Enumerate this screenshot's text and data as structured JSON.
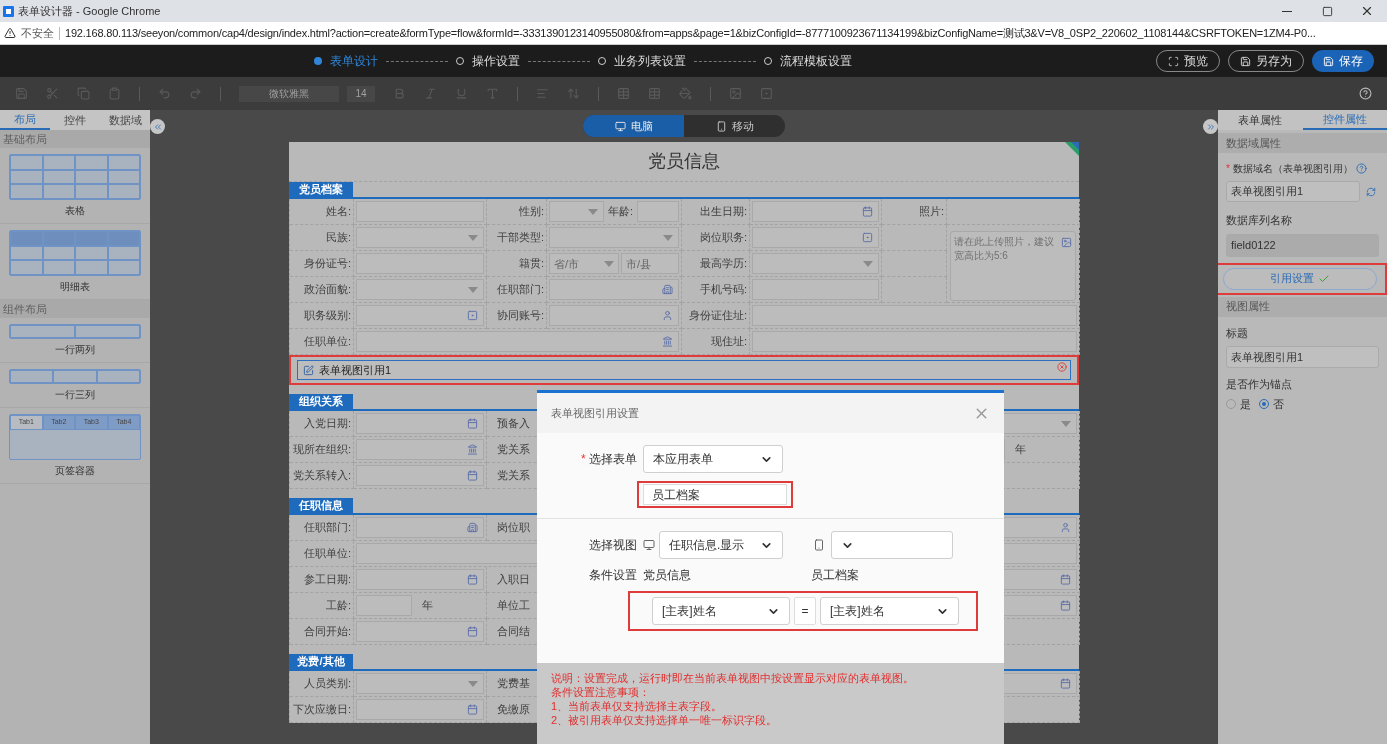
{
  "browser": {
    "title": "表单设计器 - Google Chrome",
    "security": "不安全",
    "url": "192.168.80.113/seeyon/common/cap4/design/index.html?action=create&formType=flow&formId=-3331390123140955080&from=apps&page=1&bizConfigId=-8777100923671134199&bizConfigName=测试3&V=V8_0SP2_220602_1108144&CSRFTOKEN=1ZM4-P0..."
  },
  "steps": [
    {
      "label": "表单设计",
      "selected": true
    },
    {
      "label": "操作设置",
      "selected": false
    },
    {
      "label": "业务列表设置",
      "selected": false
    },
    {
      "label": "流程模板设置",
      "selected": false
    }
  ],
  "header_buttons": [
    {
      "label": "预览",
      "kind": "preview"
    },
    {
      "label": "另存为",
      "kind": "saveas"
    },
    {
      "label": "保存",
      "kind": "save"
    }
  ],
  "toolbar": {
    "font": "微软雅黑",
    "size": "14"
  },
  "left_panel": {
    "tabs": [
      {
        "label": "布局",
        "selected": true
      },
      {
        "label": "控件",
        "selected": false
      },
      {
        "label": "数据域",
        "selected": false
      }
    ],
    "groups": [
      {
        "title": "基础布局",
        "items": [
          {
            "label": "表格",
            "kind": "table"
          },
          {
            "label": "明细表",
            "kind": "detail"
          }
        ]
      },
      {
        "title": "组件布局",
        "items": [
          {
            "label": "一行两列",
            "kind": "two"
          },
          {
            "label": "一行三列",
            "kind": "three"
          },
          {
            "label": "页签容器",
            "kind": "tabs",
            "tabs": [
              "Tab1",
              "Tab2",
              "Tab3",
              "Tab4"
            ]
          }
        ]
      }
    ]
  },
  "device_toggle": [
    {
      "label": "电脑",
      "kind": "desktop",
      "selected": true
    },
    {
      "label": "移动",
      "kind": "mobile",
      "selected": false
    }
  ],
  "form": {
    "title": "党员信息",
    "main_section": {
      "title": "党员档案",
      "rows": [
        [
          {
            "kind": "label",
            "text": "姓名:"
          },
          {
            "kind": "field"
          },
          {
            "kind": "label",
            "text": "性别:"
          },
          {
            "kind": "pair",
            "text": "年龄:"
          },
          {
            "kind": "label",
            "text": "出生日期:"
          },
          {
            "kind": "date"
          },
          {
            "kind": "label",
            "text": "照片:"
          },
          ""
        ],
        [
          {
            "kind": "label",
            "text": "民族:"
          },
          {
            "kind": "select"
          },
          {
            "kind": "label",
            "text": "干部类型:"
          },
          {
            "kind": "select"
          },
          {
            "kind": "label",
            "text": "岗位职务:"
          },
          {
            "kind": "popup"
          },
          "",
          {
            "kind": "photo",
            "text": "请在此上传照片，建议宽高比为5:6"
          }
        ],
        [
          {
            "kind": "label",
            "text": "身份证号:"
          },
          {
            "kind": "field"
          },
          {
            "kind": "label",
            "text": "籍贯:"
          },
          {
            "kind": "region",
            "placeholders": [
              "省/市",
              "市/县"
            ]
          },
          {
            "kind": "label",
            "text": "最高学历:"
          },
          {
            "kind": "select"
          },
          "",
          {
            "kind": "merged_up"
          }
        ],
        [
          {
            "kind": "label",
            "text": "政治面貌:"
          },
          {
            "kind": "select"
          },
          {
            "kind": "label",
            "text": "任职部门:"
          },
          {
            "kind": "dept"
          },
          {
            "kind": "label",
            "text": "手机号码:"
          },
          {
            "kind": "field"
          },
          "",
          {
            "kind": "merged_up"
          }
        ],
        [
          {
            "kind": "label",
            "text": "职务级别:"
          },
          {
            "kind": "popup"
          },
          {
            "kind": "label",
            "text": "协同账号:"
          },
          {
            "kind": "person"
          },
          {
            "kind": "label",
            "text": "身份证住址:"
          },
          {
            "kind": "field"
          },
          {
            "kind": "merged"
          },
          {
            "kind": "merged"
          }
        ],
        [
          {
            "kind": "label",
            "text": "任职单位:"
          },
          {
            "kind": "org"
          },
          {
            "kind": "merged"
          },
          {
            "kind": "merged"
          },
          {
            "kind": "label",
            "text": "现住址:"
          },
          {
            "kind": "field"
          },
          {
            "kind": "merged"
          },
          {
            "kind": "merged"
          }
        ]
      ]
    },
    "reference": {
      "label": "表单视图引用1",
      "highlighted": true
    },
    "sections": [
      {
        "title": "组织关系",
        "rows": [
          [
            {
              "kind": "label",
              "text": "入党日期:"
            },
            {
              "kind": "date"
            },
            {
              "kind": "caption",
              "text": "预备入"
            },
            "",
            "",
            "",
            "",
            {
              "kind": "select"
            }
          ],
          [
            {
              "kind": "label",
              "text": "现所在组织:"
            },
            {
              "kind": "org"
            },
            {
              "kind": "caption",
              "text": "党关系"
            },
            "",
            "",
            "",
            "",
            {
              "kind": "unit",
              "text": "年"
            }
          ],
          [
            {
              "kind": "label",
              "text": "党关系转入:"
            },
            {
              "kind": "date"
            },
            {
              "kind": "caption",
              "text": "党关系"
            },
            "",
            "",
            "",
            "",
            ""
          ]
        ]
      },
      {
        "title": "任职信息",
        "rows": [
          [
            {
              "kind": "label",
              "text": "任职部门:"
            },
            {
              "kind": "dept"
            },
            {
              "kind": "caption",
              "text": "岗位职"
            },
            "",
            "",
            "",
            "",
            {
              "kind": "person"
            }
          ],
          [
            {
              "kind": "label",
              "text": "任职单位:"
            },
            {
              "kind": "field"
            },
            {
              "kind": "merged"
            },
            {
              "kind": "merged"
            },
            {
              "kind": "merged"
            },
            {
              "kind": "merged"
            },
            {
              "kind": "merged"
            },
            {
              "kind": "merged"
            }
          ],
          [
            {
              "kind": "label",
              "text": "参工日期:"
            },
            {
              "kind": "date"
            },
            {
              "kind": "caption",
              "text": "入职日"
            },
            "",
            "",
            "",
            "",
            {
              "kind": "date"
            }
          ],
          [
            {
              "kind": "label",
              "text": "工龄:"
            },
            {
              "kind": "unit",
              "text": "年"
            },
            {
              "kind": "caption",
              "text": "单位工"
            },
            "",
            "",
            "",
            "",
            {
              "kind": "date"
            }
          ],
          [
            {
              "kind": "label",
              "text": "合同开始:"
            },
            {
              "kind": "date"
            },
            {
              "kind": "caption",
              "text": "合同结"
            },
            "",
            "",
            "",
            "",
            ""
          ]
        ]
      },
      {
        "title": "党费/其他",
        "rows": [
          [
            {
              "kind": "label",
              "text": "人员类别:"
            },
            {
              "kind": "select"
            },
            {
              "kind": "caption",
              "text": "党费基"
            },
            "",
            "",
            "",
            "",
            {
              "kind": "date"
            }
          ],
          [
            {
              "kind": "label",
              "text": "下次应缴日:"
            },
            {
              "kind": "date"
            },
            {
              "kind": "caption",
              "text": "免缴原"
            },
            "",
            "",
            "",
            "",
            ""
          ]
        ]
      }
    ]
  },
  "right_panel": {
    "tabs": [
      {
        "label": "表单属性",
        "selected": false
      },
      {
        "label": "控件属性",
        "selected": true
      }
    ],
    "data_section": "数据域属性",
    "domain_field": {
      "required_mark": "*",
      "label": "数据域名（表单视图引用）",
      "value": "表单视图引用1"
    },
    "column_field": {
      "label": "数据库列名称",
      "value": "field0122",
      "disabled": true
    },
    "ref_button": {
      "label": "引用设置",
      "done": true,
      "highlighted": true
    },
    "view_section": "视图属性",
    "title_field": {
      "label": "标题",
      "value": "表单视图引用1"
    },
    "anchor": {
      "label": "是否作为锚点",
      "options": [
        {
          "label": "是",
          "selected": false
        },
        {
          "label": "否",
          "selected": true
        }
      ]
    }
  },
  "dialog": {
    "title": "表单视图引用设置",
    "form_select": {
      "required_mark": "*",
      "label": "选择表单",
      "value": "本应用表单"
    },
    "form_name": {
      "value": "员工档案",
      "highlighted": true
    },
    "view_select": {
      "label": "选择视图",
      "pc_value": "任职信息.显示"
    },
    "condition": {
      "label": "条件设置",
      "left_heading": "党员信息",
      "right_heading": "员工档案",
      "left": "[主表]姓名",
      "operator": "=",
      "right": "[主表]姓名",
      "highlighted": true
    },
    "notes": [
      "说明：设置完成，运行时即在当前表单视图中按设置显示对应的表单视图。",
      "条件设置注意事项：",
      "1、当前表单仅支持选择主表字段。",
      "2、被引用表单仅支持选择单一唯一标识字段。"
    ]
  }
}
